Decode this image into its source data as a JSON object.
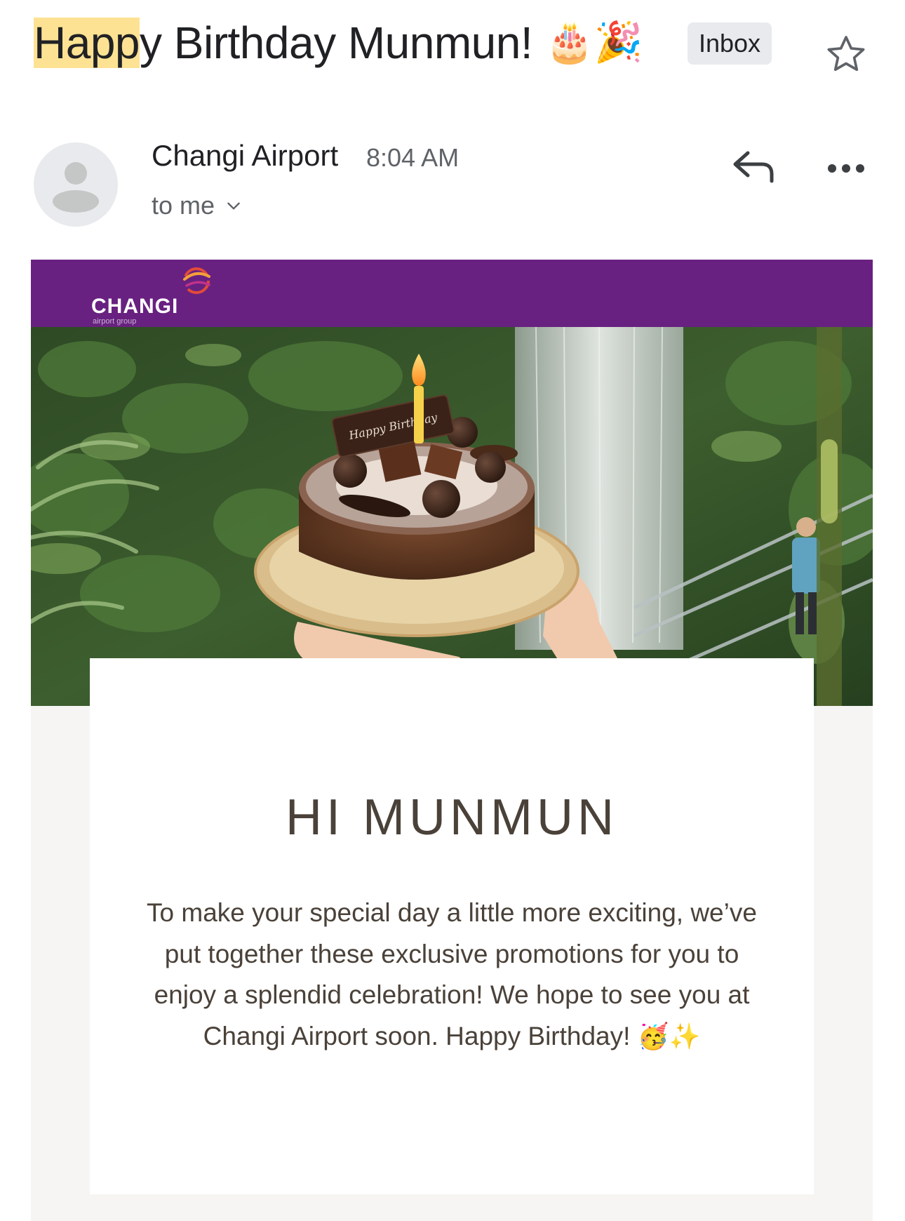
{
  "subject": {
    "highlight": "Happ",
    "rest": "y Birthday Munmun!",
    "emoji": "🎂🎉"
  },
  "labels": {
    "inbox": "Inbox"
  },
  "sender": {
    "name": "Changi Airport",
    "time": "8:04 AM",
    "recipient": "to me"
  },
  "icons": [
    "star-icon",
    "avatar-icon",
    "chevron-down-icon",
    "reply-icon",
    "more-icon"
  ],
  "email": {
    "brand": {
      "name": "CHANGI",
      "subtitle": "airport group",
      "color": "#682180"
    },
    "greeting": "HI MUNMUN",
    "message": "To make your special day a little more exciting, we’ve put together these exclusive promotions for you to enjoy a splendid celebration! We hope to see you at Changi Airport soon. Happy Birthday!",
    "message_emoji": "🥳✨",
    "cake_plaque": "Happy Birthday"
  }
}
